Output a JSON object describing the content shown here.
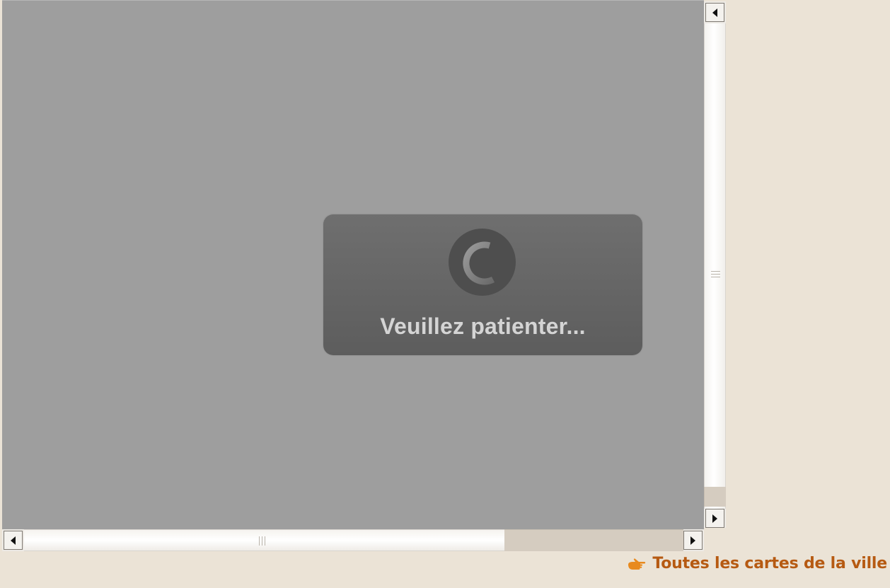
{
  "loading": {
    "message": "Veuillez patienter...",
    "spinner_icon": "loading-spinner-icon"
  },
  "scrollbars": {
    "vertical": {
      "up_icon": "arrow-left-icon",
      "down_icon": "arrow-right-icon",
      "grip_icon": "grip-lines-icon"
    },
    "horizontal": {
      "left_icon": "arrow-left-icon",
      "right_icon": "arrow-right-icon",
      "grip_icon": "grip-lines-icon"
    }
  },
  "footer": {
    "all_maps_label": "Toutes les cartes de la ville",
    "link_icon": "pointing-hand-icon"
  },
  "colors": {
    "background": "#ebe3d6",
    "overlay": "#9e9e9e",
    "dialog": "#666666",
    "link": "#b65a12"
  }
}
